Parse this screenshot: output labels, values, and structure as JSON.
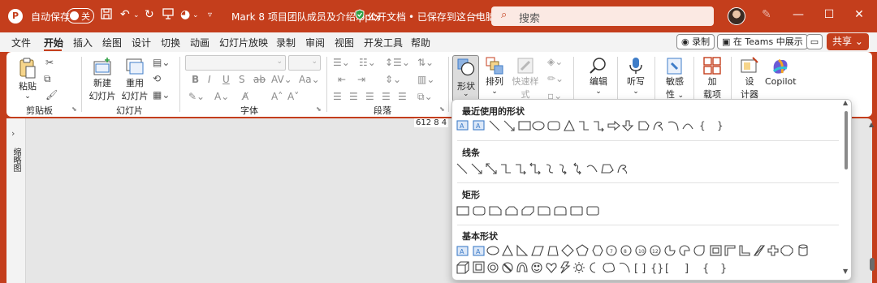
{
  "titlebar": {
    "app_logo": "P",
    "autosave_label": "自动保存",
    "autosave_state": "关",
    "doc_title": "Mark 8 项目团队成员及介绍.pptx",
    "sensitivity": "公开文档",
    "save_status": "• 已保存到这台电脑",
    "search_placeholder": "搜索"
  },
  "tabs": [
    "文件",
    "开始",
    "插入",
    "绘图",
    "设计",
    "切换",
    "动画",
    "幻灯片放映",
    "录制",
    "审阅",
    "视图",
    "开发工具",
    "帮助"
  ],
  "menu_buttons": {
    "record": "录制",
    "teams": "在 Teams 中展示",
    "share": "共享"
  },
  "ribbon": {
    "paste": "粘贴",
    "clipboard_group": "剪贴板",
    "new_slide": "新建",
    "new_slide2": "幻灯片",
    "reuse": "重用",
    "reuse2": "幻灯片",
    "slides_group": "幻灯片",
    "font_group": "字体",
    "para_group": "段落",
    "shapes": "形状",
    "arrange": "排列",
    "quick_styles": "快速样式",
    "editing": "编辑",
    "dictate": "听写",
    "sensitivity": "敏感",
    "sensitivity2": "性",
    "addins": "加",
    "addins2": "载项",
    "designer": "设",
    "designer2": "计器",
    "copilot": "Copilot"
  },
  "zoom_readout": "612 8  4",
  "left_pane_label": "缩略图",
  "gallery": {
    "recent": "最近使用的形状",
    "lines": "线条",
    "rectangles": "矩形",
    "basic": "基本形状"
  },
  "colors": {
    "accent": "#c43e1c",
    "selected": "#dcdcdc"
  }
}
